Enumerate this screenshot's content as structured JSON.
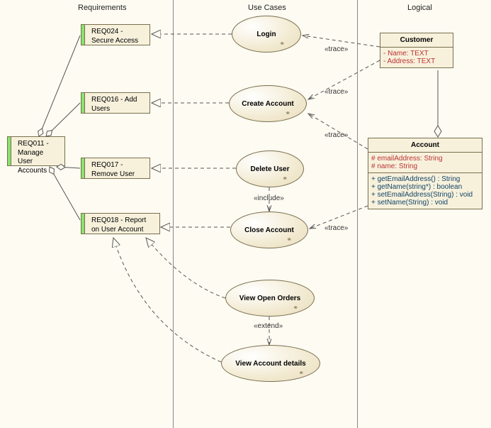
{
  "swimlanes": {
    "requirements": "Requirements",
    "usecases": "Use Cases",
    "logical": "Logical"
  },
  "requirements": {
    "req024": "REQ024 - Secure Access",
    "req016": "REQ016 - Add Users",
    "req011": "REQ011 - Manage User Accounts",
    "req017": "REQ017 - Remove User",
    "req018": "REQ018 - Report on User Account"
  },
  "usecases": {
    "login": "Login",
    "create_account": "Create Account",
    "delete_user": "Delete User",
    "close_account": "Close Account",
    "view_open_orders": "View Open Orders",
    "view_account_details": "View Account details"
  },
  "classes": {
    "customer": {
      "name": "Customer",
      "attrs": [
        "-   Name:  TEXT",
        "-   Address:  TEXT"
      ]
    },
    "account": {
      "name": "Account",
      "attrs": [
        "#   emailAddress:  String",
        "#   name:  String"
      ],
      "ops": [
        "+   getEmailAddress() : String",
        "+   getName(string*) : boolean",
        "+   setEmailAddress(String) : void",
        "+   setName(String) : void"
      ]
    }
  },
  "stereotypes": {
    "trace": "«trace»",
    "include": "«include»",
    "extend": "«extend»"
  }
}
